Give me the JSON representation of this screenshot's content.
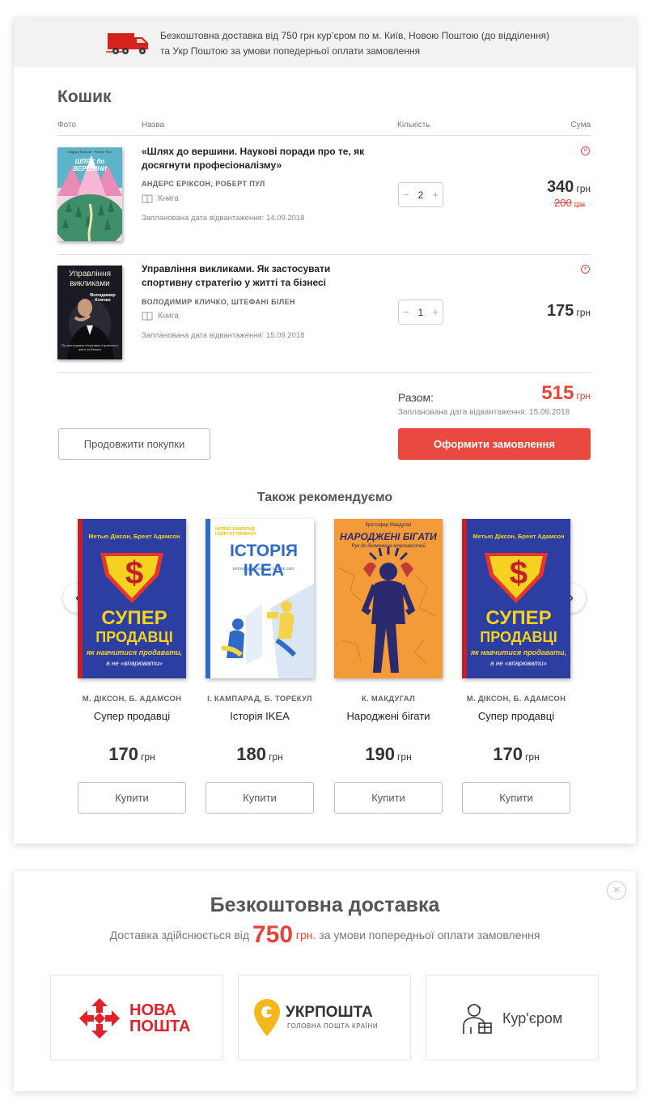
{
  "banner": {
    "line1": "Безкоштовна доставка від 750 грн кур’єром по м. Київ, Новою Поштою (до відділення)",
    "line2": "та Укр Поштою за умови попедерньої оплати замовлення"
  },
  "cart": {
    "title": "Кошик",
    "columns": {
      "photo": "Фото",
      "name": "Назва",
      "qty": "Кількість",
      "sum": "Сума"
    },
    "items": [
      {
        "title": "«Шлях до вершини. Наукові поради про те, як досягнути професіоналізму»",
        "authors": "АНДЕРС ЕРІКСОН, РОБЕРТ ПУЛ",
        "type": "Книга",
        "ship_date": "Запланована дата відвантаження: 14.09.2018",
        "qty": "2",
        "price": "340",
        "old_price": "200",
        "currency": "грн",
        "cover": {
          "top": "Андерс Еріксон · Роберт Пул",
          "title": "ШЛЯХ до ВЕРШИНИ"
        }
      },
      {
        "title": "Управління викликами. Як застосувати спортивну стратегію у житті та бізнесі",
        "authors": "ВОЛОДИМИР КЛИЧКО, ШТЕФАНІ БІЛЕН",
        "type": "Книга",
        "ship_date": "Запланована дата відвантаження: 15.09.2018",
        "qty": "1",
        "price": "175",
        "currency": "грн",
        "cover": {
          "title1": "Управління",
          "title2": "викликами",
          "author": "Володимир Кличко",
          "bottom": "Як застосувати спортивну стратегію у житті та бізнесі"
        }
      }
    ],
    "qty_minus": "−",
    "qty_plus": "+",
    "remove_icon": "×",
    "total_label": "Разом:",
    "total_value": "515",
    "total_currency": "грн",
    "total_ship": "Запланована дата відвантаження: 15.09.2018",
    "continue_label": "Продовжити покупки",
    "checkout_label": "Оформити замовлення"
  },
  "reco": {
    "title": "Також рекомендуємо",
    "prev_icon": "‹",
    "next_icon": "›",
    "currency": "грн",
    "buy_label": "Купити",
    "items": [
      {
        "authors": "М. ДІКСОН, Б. АДАМСОН",
        "name": "Супер продавці",
        "price": "170",
        "cover": {
          "top": "Метью Діксон, Брент Адамсон",
          "t1": "СУПЕР",
          "t2": "ПРОДАВЦІ",
          "sub": "як навчитися продавати,",
          "sub2": "а не «впарювати»"
        }
      },
      {
        "authors": "І. КАМПАРАД, Б. ТОРЕКУЛ",
        "name": "Історія IKEA",
        "price": "180",
        "cover": {
          "top1": "ІНГВАР КАМПРАД",
          "top2": "І БЕРТІЛ ТОРЕКУЛ",
          "t1": "ІСТОРІЯ IKEA",
          "sub": "БРЕНД, ЩО ЗАКОХАВ У СЕБЕ СВІТ"
        }
      },
      {
        "authors": "К. МАКДУГАЛ",
        "name": "Народжені бігати",
        "price": "190",
        "cover": {
          "top": "Крістофер Макдугал",
          "t1": "НАРОДЖЕНІ БІГАТИ",
          "sub": "Рух до безмежних можливостей"
        }
      },
      {
        "authors": "М. ДІКСОН, Б. АДАМСОН",
        "name": "Супер продавці",
        "price": "170",
        "cover": {
          "top": "Метью Діксон, Брент Адамсон",
          "t1": "СУПЕР",
          "t2": "ПРОДАВЦІ",
          "sub": "як навчитися продавати,",
          "sub2": "а не «впарювати»"
        }
      }
    ]
  },
  "delivery": {
    "title": "Безкоштовна доставка",
    "sub_before": "Доставка здійснюється від",
    "sub_amount": "750",
    "sub_currency": "грн.",
    "sub_after": "за умови попередньої оплати замовлення",
    "close_icon": "×",
    "nova": {
      "line1": "НОВА",
      "line2": "ПОШТА"
    },
    "ukr": {
      "line1": "УКРПОШТА",
      "line2": "ГОЛОВНА ПОШТА КРАЇНИ"
    },
    "courier": "Кур'єром"
  },
  "colors": {
    "accent": "#e9493f",
    "price_red": "#e5453b",
    "banner_bg": "#f2f2f2"
  }
}
